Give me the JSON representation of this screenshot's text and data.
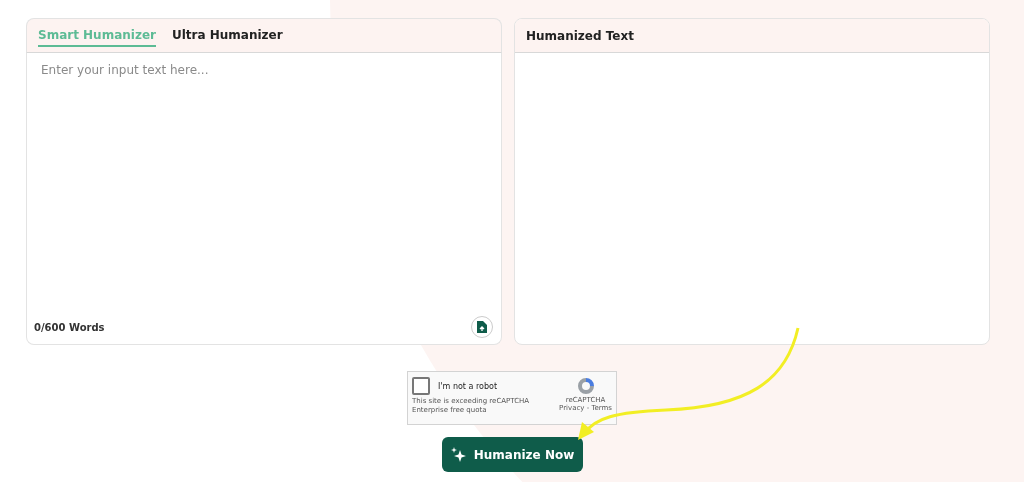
{
  "input_panel": {
    "tabs": [
      {
        "label": "Smart Humanizer",
        "selected": true
      },
      {
        "label": "Ultra Humanizer",
        "selected": false
      }
    ],
    "input": {
      "placeholder": "Enter your input text here..."
    },
    "word_count": "0/600 Words"
  },
  "output_panel": {
    "title": "Humanized Text"
  },
  "captcha": {
    "checked": false,
    "label": "I'm not a robot",
    "notice": "This site is exceeding reCAPTCHA Enterprise free quota",
    "brand": "reCAPTCHA",
    "links": "Privacy - Terms"
  },
  "submit_button": {
    "label": "Humanize Now"
  }
}
